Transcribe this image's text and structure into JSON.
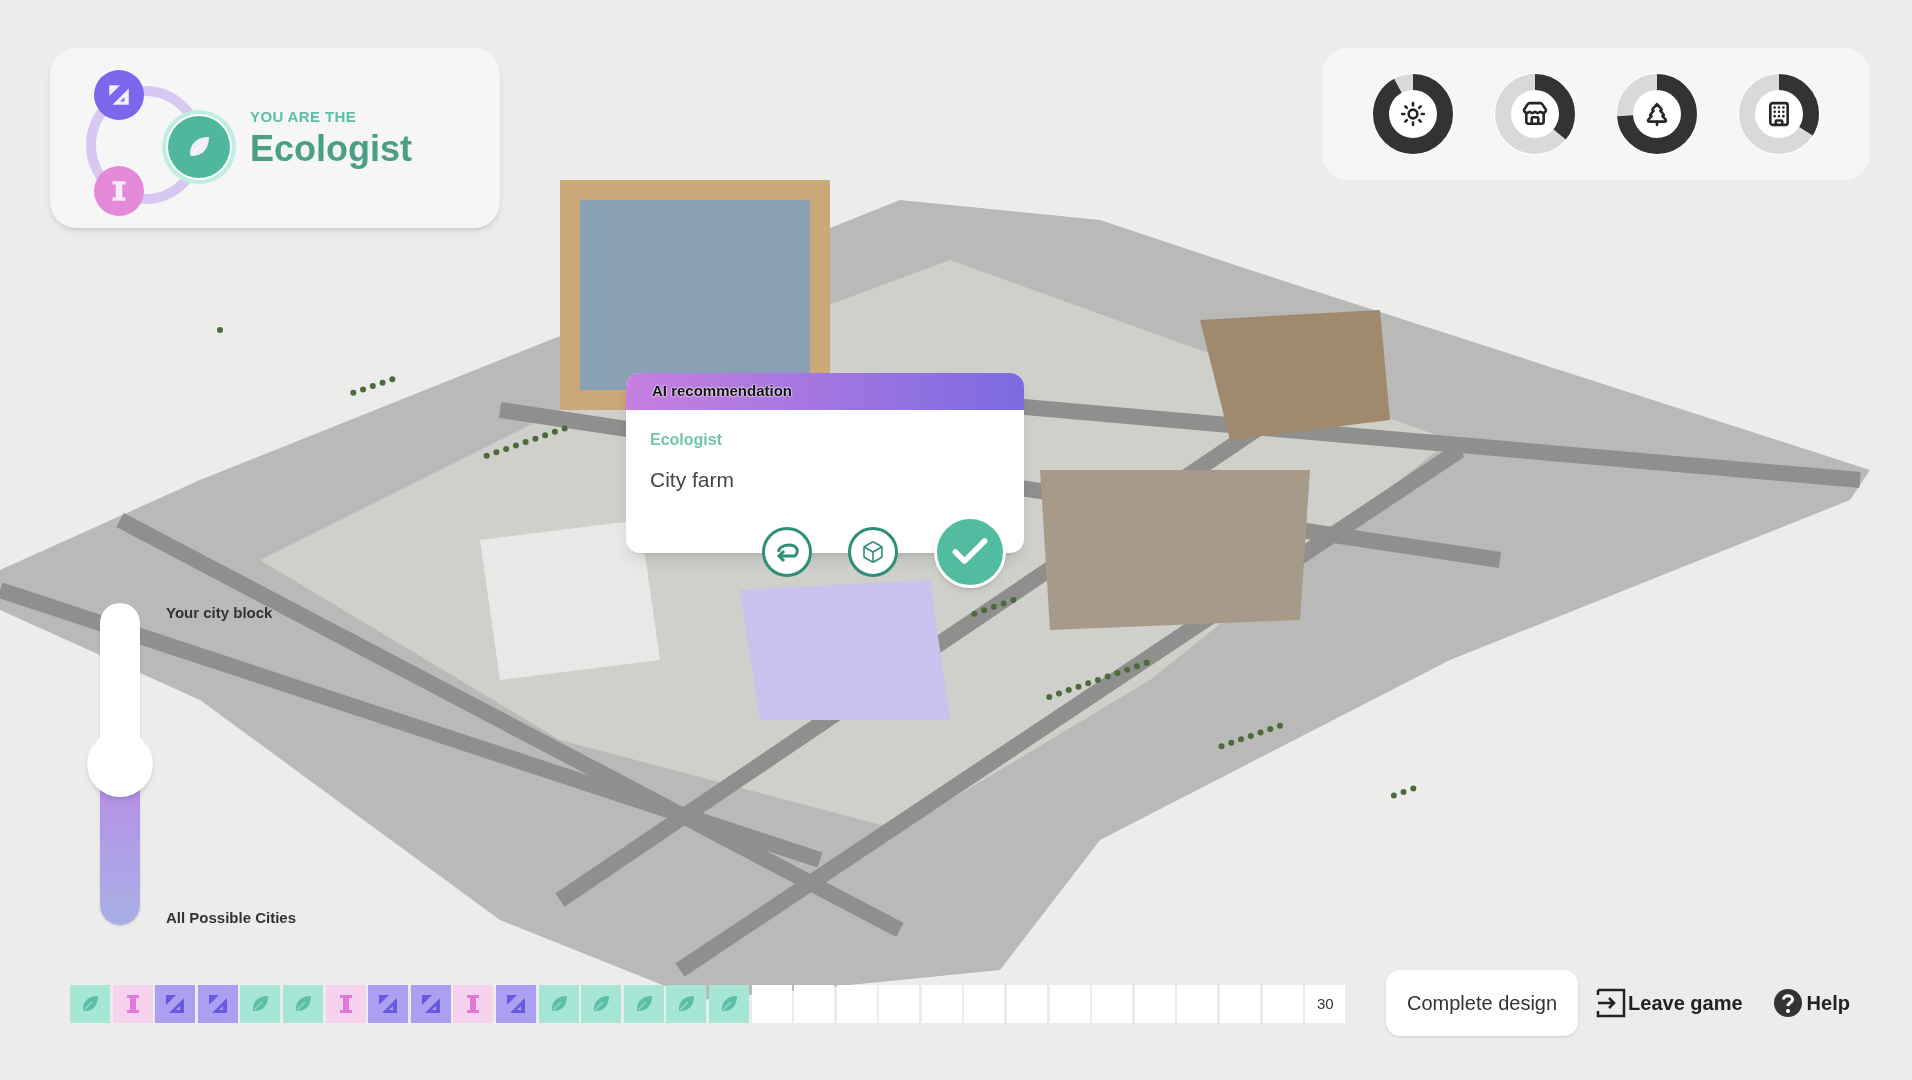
{
  "role_card": {
    "caption": "YOU ARE THE",
    "role": "Ecologist",
    "roles": [
      {
        "kind": "ruler",
        "selected": false
      },
      {
        "kind": "leaf",
        "selected": true
      },
      {
        "kind": "pillar",
        "selected": false
      }
    ]
  },
  "gauges": [
    {
      "kind": "sun",
      "level": 0.92
    },
    {
      "kind": "shop",
      "level": 0.36
    },
    {
      "kind": "tree",
      "level": 0.74
    },
    {
      "kind": "building",
      "level": 0.34
    }
  ],
  "recommendation": {
    "title": "AI recommendation",
    "role": "Ecologist",
    "suggestion": "City farm"
  },
  "scale_slider": {
    "top_label": "Your city block",
    "bottom_label": "All Possible Cities",
    "level": 0.5
  },
  "turns": [
    {
      "kind": "leaf"
    },
    {
      "kind": "pillar"
    },
    {
      "kind": "ruler"
    },
    {
      "kind": "ruler"
    },
    {
      "kind": "leaf"
    },
    {
      "kind": "leaf"
    },
    {
      "kind": "pillar"
    },
    {
      "kind": "ruler"
    },
    {
      "kind": "ruler"
    },
    {
      "kind": "pillar"
    },
    {
      "kind": "ruler"
    },
    {
      "kind": "leaf"
    },
    {
      "kind": "leaf"
    },
    {
      "kind": "leaf"
    },
    {
      "kind": "leaf"
    },
    {
      "kind": "leaf"
    },
    {
      "kind": "empty"
    },
    {
      "kind": "empty"
    },
    {
      "kind": "empty"
    },
    {
      "kind": "empty"
    },
    {
      "kind": "empty"
    },
    {
      "kind": "empty"
    },
    {
      "kind": "empty"
    },
    {
      "kind": "empty"
    },
    {
      "kind": "empty"
    },
    {
      "kind": "empty"
    },
    {
      "kind": "empty"
    },
    {
      "kind": "empty"
    },
    {
      "kind": "empty"
    }
  ],
  "turn_total": "30",
  "buttons": {
    "complete": "Complete design",
    "leave": "Leave game",
    "help": "Help"
  }
}
